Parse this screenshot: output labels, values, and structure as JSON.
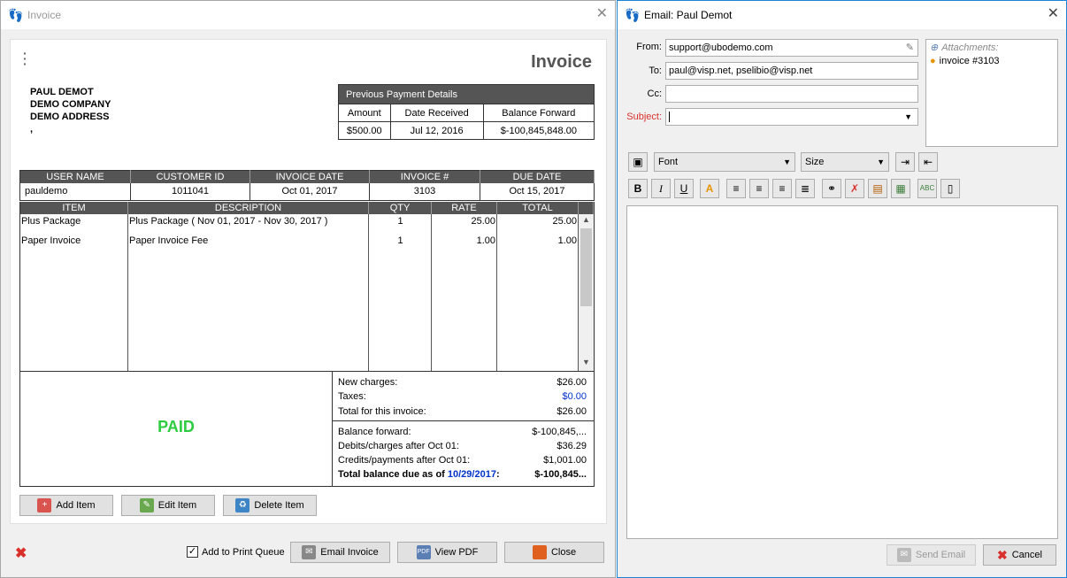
{
  "invoice_window": {
    "title": "Invoice",
    "heading": "Invoice",
    "address": [
      "PAUL DEMOT",
      "DEMO COMPANY",
      "DEMO ADDRESS",
      ","
    ],
    "previous_payment": {
      "title": "Previous Payment Details",
      "headers": [
        "Amount",
        "Date Received",
        "Balance Forward"
      ],
      "row": [
        "$500.00",
        "Jul 12, 2016",
        "$-100,845,848.00"
      ]
    },
    "info_headers": [
      "USER NAME",
      "CUSTOMER ID",
      "INVOICE DATE",
      "INVOICE #",
      "DUE DATE"
    ],
    "info_row": [
      "pauldemo",
      "1011041",
      "Oct 01, 2017",
      "3103",
      "Oct 15, 2017"
    ],
    "item_headers": [
      "ITEM",
      "DESCRIPTION",
      "QTY",
      "RATE",
      "TOTAL"
    ],
    "items": [
      {
        "item": "Plus Package",
        "description": "Plus Package ( Nov 01, 2017 - Nov 30, 2017 )",
        "qty": "1",
        "rate": "25.00",
        "total": "25.00"
      },
      {
        "item": "Paper Invoice",
        "description": "Paper Invoice Fee",
        "qty": "1",
        "rate": "1.00",
        "total": "1.00"
      }
    ],
    "status": "PAID",
    "summary1": [
      {
        "label": "New charges:",
        "value": "$26.00"
      },
      {
        "label": "Taxes:",
        "value": "$0.00"
      },
      {
        "label": "Total for this invoice:",
        "value": "$26.00"
      }
    ],
    "summary2": [
      {
        "label": "Balance forward:",
        "value": "$-100,845,..."
      },
      {
        "label": "Debits/charges after Oct 01:",
        "value": "$36.29"
      },
      {
        "label": "Credits/payments after Oct 01:",
        "value": "$1,001.00"
      }
    ],
    "total_due": {
      "prefix": "Total balance due as of ",
      "date": "10/29/2017",
      "suffix": ":",
      "value": "$-100,845..."
    },
    "buttons": {
      "add": "Add Item",
      "edit": "Edit Item",
      "delete": "Delete Item",
      "email": "Email Invoice",
      "pdf": "View PDF",
      "close": "Close"
    },
    "print_queue": "Add to Print Queue",
    "print_queue_checked": true,
    "colors": {
      "paid": "#2ecc40",
      "link_date": "#0033cc",
      "taxes": "#0033cc"
    }
  },
  "email_window": {
    "title": "Email: Paul Demot",
    "from_label": "From:",
    "from_value": "support@ubodemo.com",
    "to_label": "To:",
    "to_value": "paul@visp.net, pselibio@visp.net",
    "cc_label": "Cc:",
    "cc_value": "",
    "subject_label": "Subject:",
    "subject_value": "",
    "attachments_label": "Attachments:",
    "attachment": "invoice #3103",
    "font_select": "Font",
    "size_select": "Size",
    "send_button": "Send Email",
    "cancel_button": "Cancel",
    "bold": "B",
    "italic": "I",
    "underline": "U"
  }
}
